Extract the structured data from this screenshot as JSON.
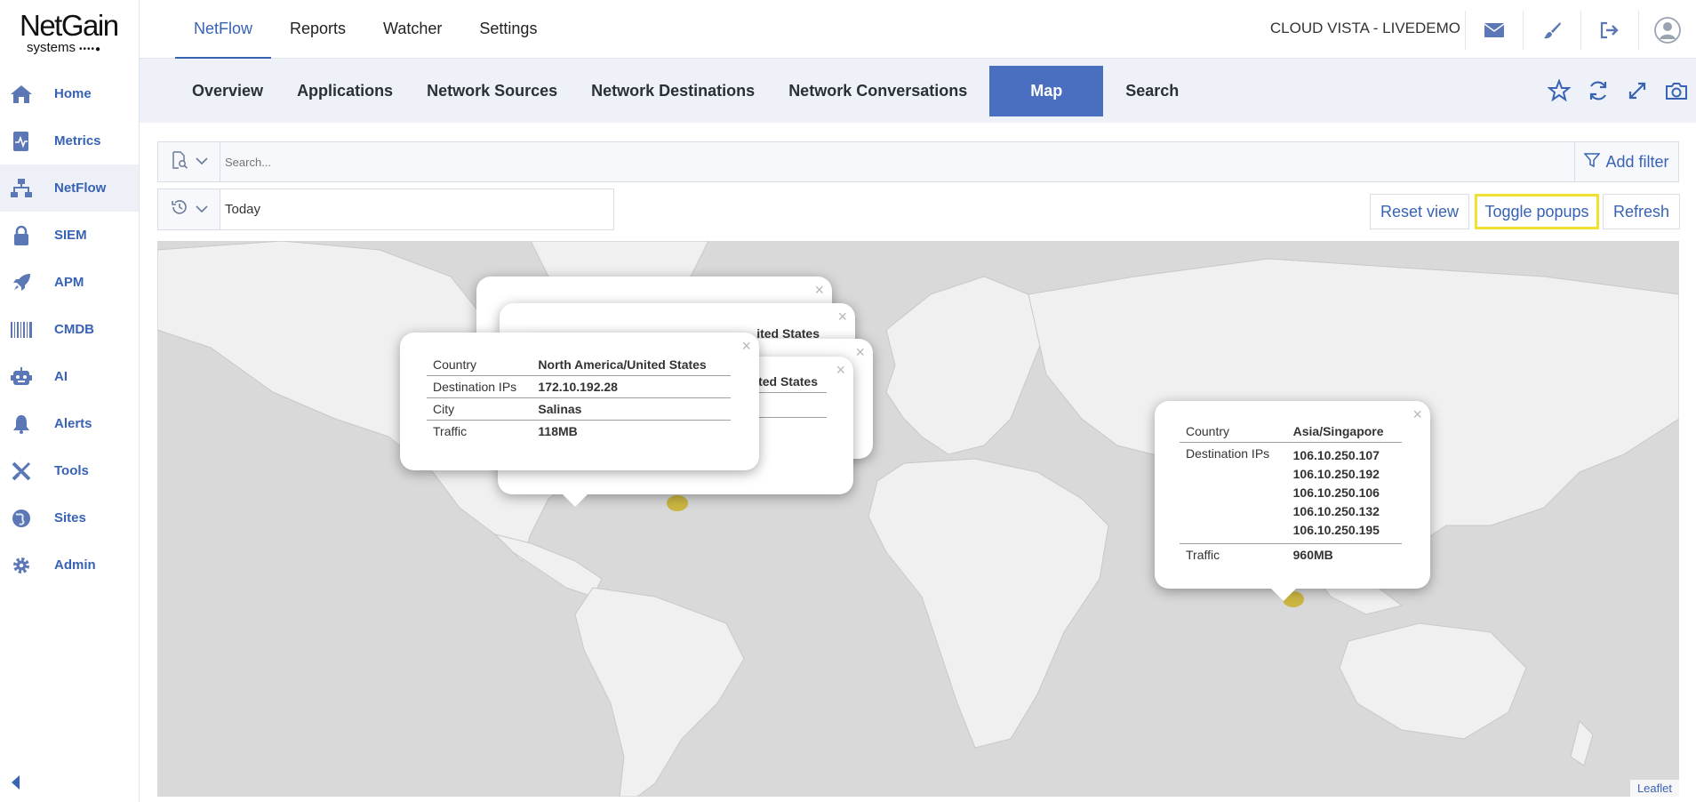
{
  "brand": {
    "name": "NetGain",
    "sub": "systems",
    "dots": "••••●"
  },
  "sidebar": {
    "items": [
      {
        "label": "Home",
        "icon": "home-icon"
      },
      {
        "label": "Metrics",
        "icon": "metrics-icon"
      },
      {
        "label": "NetFlow",
        "icon": "netflow-icon"
      },
      {
        "label": "SIEM",
        "icon": "lock-icon"
      },
      {
        "label": "APM",
        "icon": "rocket-icon"
      },
      {
        "label": "CMDB",
        "icon": "barcode-icon"
      },
      {
        "label": "AI",
        "icon": "robot-icon"
      },
      {
        "label": "Alerts",
        "icon": "bell-icon"
      },
      {
        "label": "Tools",
        "icon": "tools-icon"
      },
      {
        "label": "Sites",
        "icon": "globe-icon"
      },
      {
        "label": "Admin",
        "icon": "gear-icon"
      }
    ],
    "active": "NetFlow"
  },
  "topnav": {
    "tabs": [
      "NetFlow",
      "Reports",
      "Watcher",
      "Settings"
    ],
    "active": "NetFlow",
    "tenant": "CLOUD VISTA - LIVEDEMO"
  },
  "subnav": {
    "tabs": [
      "Overview",
      "Applications",
      "Network Sources",
      "Network Destinations",
      "Network Conversations",
      "Map",
      "Search"
    ],
    "active": "Map"
  },
  "filter": {
    "search_placeholder": "Search...",
    "add_filter_label": "Add filter",
    "date_value": "Today"
  },
  "buttons": {
    "reset": "Reset view",
    "toggle": "Toggle popups",
    "refresh": "Refresh"
  },
  "map": {
    "attribution": "Leaflet",
    "popup_us": {
      "country_label": "Country",
      "country": "North America/United States",
      "dest_label": "Destination IPs",
      "dest": "172.10.192.28",
      "city_label": "City",
      "city": "Salinas",
      "traffic_label": "Traffic",
      "traffic": "118MB"
    },
    "popup_back_text_1": "ited States",
    "popup_back_text_2": "ited States",
    "popup_sg": {
      "country_label": "Country",
      "country": "Asia/Singapore",
      "dest_label": "Destination IPs",
      "ips": [
        "106.10.250.107",
        "106.10.250.192",
        "106.10.250.106",
        "106.10.250.132",
        "106.10.250.195"
      ],
      "traffic_label": "Traffic",
      "traffic": "960MB"
    },
    "colors": {
      "land": "#f0f0f0",
      "water": "#d9d9d9",
      "marker": "#c8af28"
    }
  }
}
